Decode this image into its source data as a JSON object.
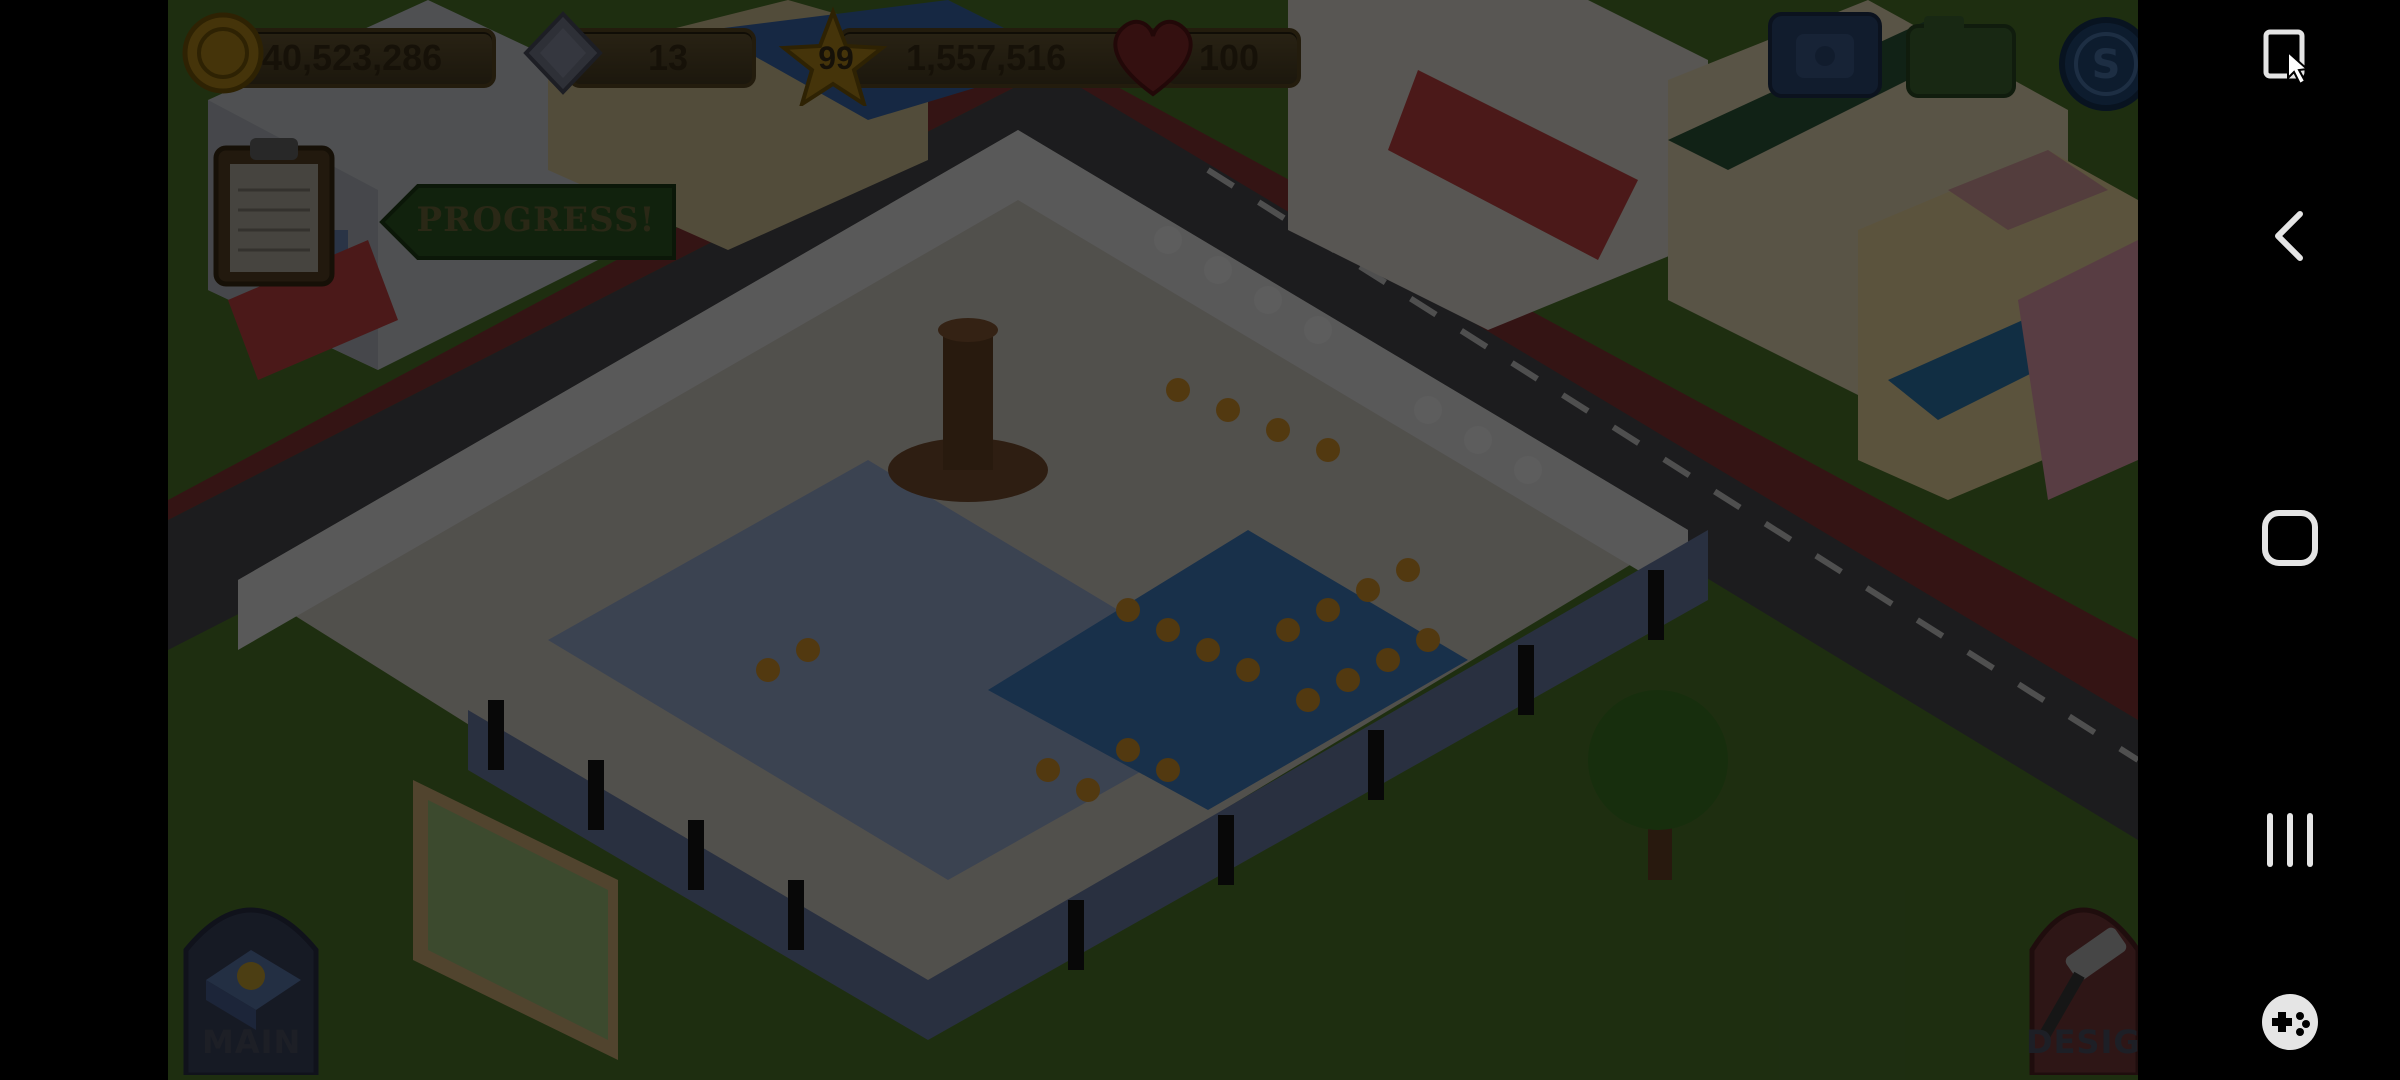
{
  "hud": {
    "coins": "40,523,286",
    "gems": "13",
    "level": "99",
    "experience": "1,557,516",
    "hearts": "100",
    "progress_button": "PROGRESS!",
    "main_button": "MAIN",
    "design_button": "DESIGN"
  },
  "icons": {
    "coins": "coin-icon",
    "gems": "gem-icon",
    "level": "star-icon",
    "hearts": "heart-icon",
    "phone": "phone-icon",
    "camera": "camera-icon",
    "special": "s-coin-icon",
    "tasks": "clipboard-icon",
    "main": "recipe-book-icon",
    "design": "paint-roller-icon"
  },
  "navbar": {
    "items": [
      "screenshot-icon",
      "back-icon",
      "home-icon",
      "recents-icon",
      "game-tools-icon"
    ]
  },
  "colors": {
    "dim_overlay": "#000000",
    "navbar_bg": "#000000",
    "hud_text": "#3b2e17",
    "grass": "#2f4a1c",
    "road": "#2a2a2c",
    "water": "#274a6e"
  }
}
